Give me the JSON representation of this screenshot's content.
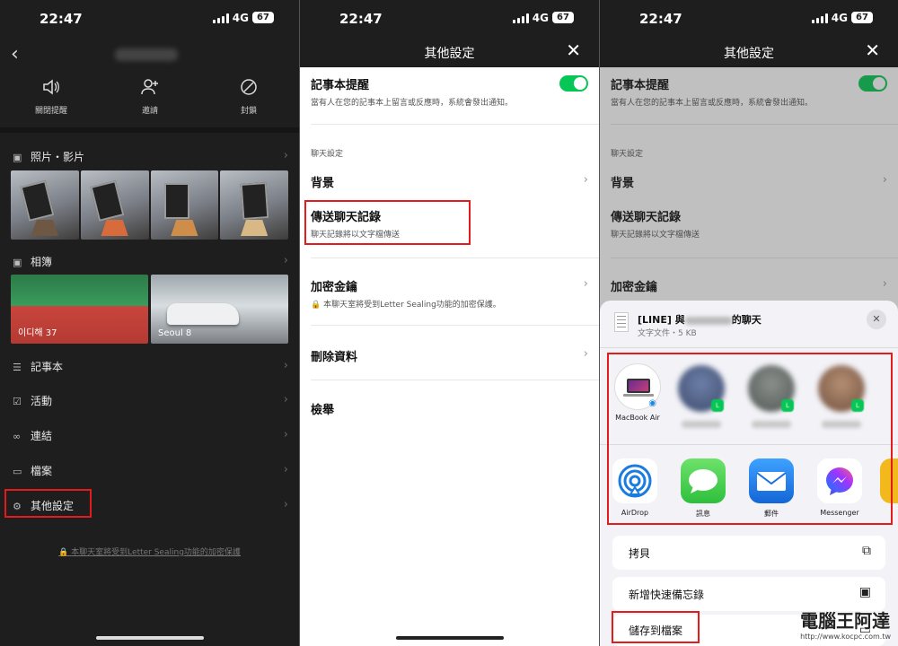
{
  "status": {
    "time": "22:47",
    "network": "4G",
    "battery": "67"
  },
  "panel1": {
    "actions": [
      {
        "label": "關閉提醒",
        "icon": "speaker-icon"
      },
      {
        "label": "邀請",
        "icon": "add-person-icon"
      },
      {
        "label": "封鎖",
        "icon": "block-icon"
      }
    ],
    "photos_label": "照片・影片",
    "album_label": "相簿",
    "albums": [
      {
        "caption": "이디해 37"
      },
      {
        "caption": "Seoul 8"
      }
    ],
    "menu": [
      "記事本",
      "活動",
      "連結",
      "檔案",
      "其他設定"
    ],
    "footer": "本聊天室將受到Letter Sealing功能的加密保護"
  },
  "settings": {
    "title": "其他設定",
    "notes_reminder": {
      "title": "記事本提醒",
      "subtitle": "當有人在您的記事本上留言或反應時，系統會發出通知。",
      "enabled": true
    },
    "chat_section": "聊天設定",
    "background": "背景",
    "send_history": {
      "title": "傳送聊天記錄",
      "subtitle": "聊天記錄將以文字檔傳送"
    },
    "encryption": {
      "title": "加密金鑰",
      "subtitle": "本聊天室將受到Letter Sealing功能的加密保護。"
    },
    "delete_data": "刪除資料",
    "report": "檢舉"
  },
  "share": {
    "file_title_prefix": "[LINE] 與",
    "file_title_suffix": "的聊天",
    "file_meta": "文字文件・5 KB",
    "airdrop_target": "MacBook Air",
    "apps": [
      "AirDrop",
      "訊息",
      "郵件",
      "Messenger"
    ],
    "actions": [
      "拷貝",
      "新增快速備忘錄",
      "儲存到檔案"
    ]
  },
  "watermark": {
    "text": "電腦王阿達",
    "url": "http://www.kocpc.com.tw"
  },
  "colors": {
    "line_green": "#06c755",
    "highlight_red": "#e31b1b"
  }
}
